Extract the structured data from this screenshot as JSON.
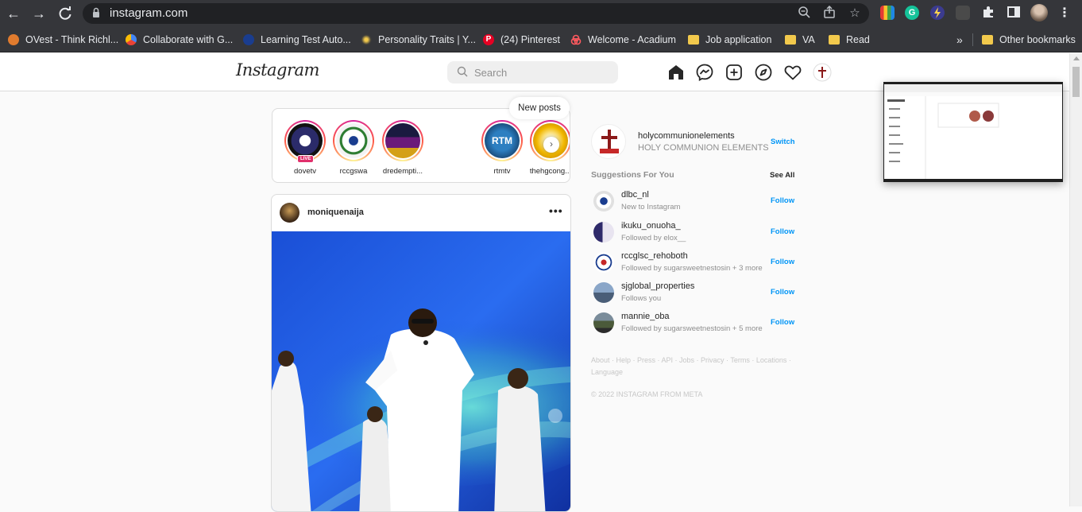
{
  "browser": {
    "url": "instagram.com",
    "bookmarks": [
      {
        "label": "OVest - Think Richl...",
        "icon": "ovest-icon"
      },
      {
        "label": "Collaborate with G...",
        "icon": "google-cloud-icon"
      },
      {
        "label": "Learning Test Auto...",
        "icon": "globe-icon"
      },
      {
        "label": "Personality Traits | Y...",
        "icon": "personality-icon"
      },
      {
        "label": "(24) Pinterest",
        "icon": "pinterest-icon"
      },
      {
        "label": "Welcome - Acadium",
        "icon": "acadium-icon"
      },
      {
        "label": "Job application",
        "icon": "folder-icon"
      },
      {
        "label": "VA",
        "icon": "folder-icon"
      },
      {
        "label": "Read",
        "icon": "folder-icon"
      }
    ],
    "overflow_label": "»",
    "other_bookmarks": "Other bookmarks"
  },
  "header": {
    "logo": "Instagram",
    "search_placeholder": "Search"
  },
  "new_posts": "New posts",
  "stories": [
    {
      "name": "dovetv",
      "live": "LIVE",
      "color": "#2b2b6a"
    },
    {
      "name": "rccgswa",
      "color": "#f3f3f3"
    },
    {
      "name": "dredempti...",
      "color": "#6a1a7a"
    },
    {
      "name": "rtmtv",
      "color": "#2d7fc1"
    },
    {
      "name": "thehgcong...",
      "color": "#f2b800"
    }
  ],
  "post": {
    "username": "moniquenaija",
    "more": "•••"
  },
  "account": {
    "username": "holycommunionelements",
    "full_name": "HOLY COMMUNION ELEMENTS",
    "switch_label": "Switch"
  },
  "suggestions": {
    "title": "Suggestions For You",
    "see_all": "See All",
    "follow_label": "Follow",
    "items": [
      {
        "username": "dlbc_nl",
        "subtitle": "New to Instagram"
      },
      {
        "username": "ikuku_onuoha_",
        "subtitle": "Followed by elox__"
      },
      {
        "username": "rccglsc_rehoboth",
        "subtitle": "Followed by sugarsweetnestosin + 3 more"
      },
      {
        "username": "sjglobal_properties",
        "subtitle": "Follows you"
      },
      {
        "username": "mannie_oba",
        "subtitle": "Followed by sugarsweetnestosin + 5 more"
      }
    ]
  },
  "footer": {
    "links": "About · Help · Press · API · Jobs · Privacy · Terms · Locations · Language",
    "copyright": "© 2022 INSTAGRAM FROM META"
  }
}
